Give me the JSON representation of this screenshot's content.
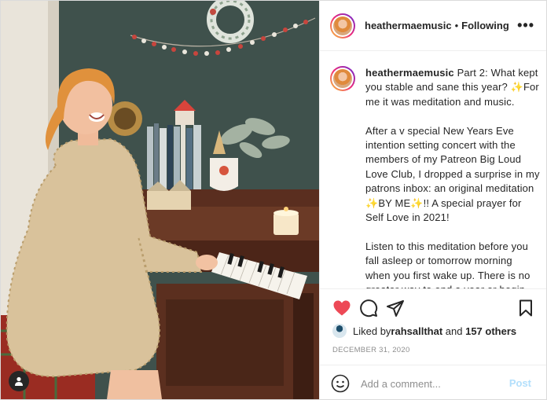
{
  "post": {
    "username": "heathermaemusic",
    "separator": "•",
    "follow_status": "Following",
    "more_label": "•••"
  },
  "caption": {
    "username": "heathermaemusic",
    "p1_a": " Part 2: What kept you stable and sane this year? ",
    "emoji_sparkle": "✨",
    "p1_b": "For me it was meditation and music.",
    "p2": "After a v special New Years Eve intention setting concert with the members of my Patreon Big Loud Love Club, I dropped a surprise in my patrons inbox: an original meditation ",
    "p2_b": "BY ME",
    "p2_c": "!! A special prayer for Self Love in 2021!",
    "p3": "Listen to this meditation before you fall asleep or tomorrow morning when you first wake up. There is no greater way to end a year or begin another new one than with a giant warm sushy hug"
  },
  "likes": {
    "prefix": "Liked by ",
    "user": "rahsallthat",
    "middle": " and ",
    "count": "157 others"
  },
  "date": "DECEMBER 31, 2020",
  "comment": {
    "placeholder": "Add a comment...",
    "post_label": "Post"
  },
  "icons": {
    "like": "heart-icon",
    "comment": "comment-icon",
    "share": "paper-plane-icon",
    "save": "bookmark-icon",
    "emoji": "smiley-icon",
    "tagged": "user-tag-icon"
  },
  "colors": {
    "like_red": "#ed4956",
    "post_disabled": "#b2dffc",
    "meta_gray": "#8e8e8e"
  }
}
